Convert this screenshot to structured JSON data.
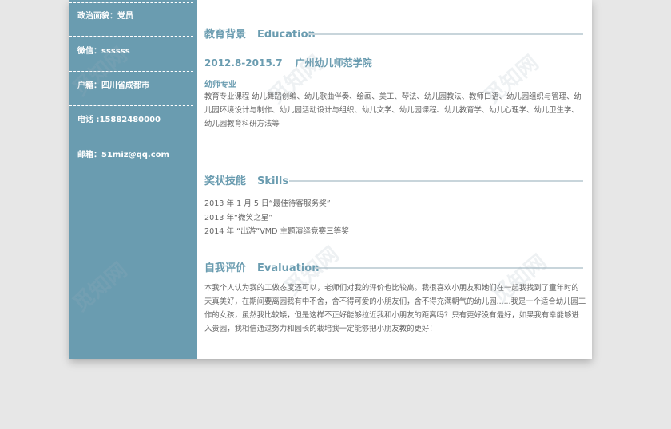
{
  "sidebar": {
    "items": [
      {
        "text": "政治面貌：党员"
      },
      {
        "text": "微信：ssssss"
      },
      {
        "text": "户籍：四川省成都市"
      },
      {
        "text": "电话 :15882480000"
      },
      {
        "text": "邮箱：51miz@qq.com"
      }
    ]
  },
  "education": {
    "title_cn": "教育背景",
    "title_en": "Education",
    "period": "2012.8-2015.7",
    "school": "广州幼儿师范学院",
    "major": "幼师专业",
    "courses": "教育专业课程 幼儿舞蹈创编、幼儿歌曲伴奏、绘画、美工、琴法、幼儿园教法、教师口语、幼儿园组织与管理、幼儿园环境设计与制作、幼儿园活动设计与组织、幼儿文学、幼儿园课程、幼儿教育学、幼儿心理学、幼儿卫生学、幼儿园教育科研方法等"
  },
  "skills": {
    "title_cn": "奖状技能",
    "title_en": "Skills",
    "awards": [
      "2013 年 1 月 5 日“最佳待客服务奖”",
      "2013 年“微笑之星”",
      "2014 年 “出游”VMD 主题演绎竞赛三等奖"
    ]
  },
  "evaluation": {
    "title_cn": "自我评价",
    "title_en": "Evaluation",
    "text": "本我个人认为我的工做态度还可以，老师们对我的评价也比较高。我很喜欢小朋友和她们在一起我找到了童年时的天真美好，在期间要离园我有中不舍，舍不得可爱的小朋友们，舍不得充满朝气的幼儿园......我是一个适合幼儿园工作的女孩，虽然我比较矮，但是这样不正好能够拉近我和小朋友的距离吗？只有更好没有最好，如果我有幸能够进入贵园，我相信通过努力和园长的栽培我一定能够把小朋友教的更好！"
  },
  "watermark": "觅知网"
}
